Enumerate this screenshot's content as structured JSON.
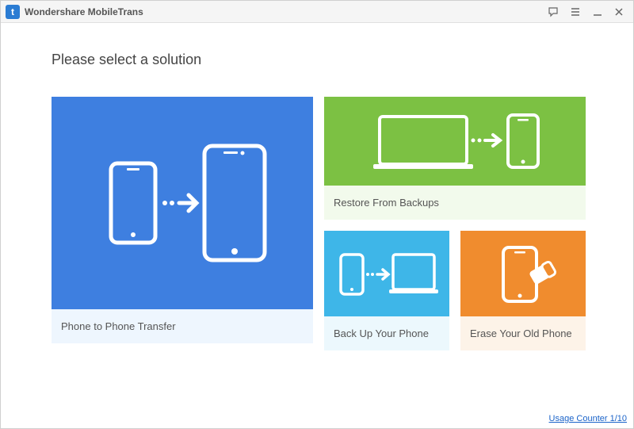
{
  "titlebar": {
    "app_name": "Wondershare MobileTrans"
  },
  "heading": "Please select a solution",
  "cards": {
    "phone_to_phone": {
      "label": "Phone to Phone Transfer"
    },
    "restore": {
      "label": "Restore From Backups"
    },
    "backup": {
      "label": "Back Up Your Phone"
    },
    "erase": {
      "label": "Erase Your Old Phone"
    }
  },
  "footer": {
    "usage_counter": "Usage Counter 1/10"
  },
  "icons": {
    "feedback": "feedback-icon",
    "menu": "menu-icon",
    "minimize": "minimize-icon",
    "close": "close-icon"
  },
  "colors": {
    "blue": "#3e7fe0",
    "green": "#7cc143",
    "cyan": "#3eb6e8",
    "orange": "#f08c2e"
  }
}
